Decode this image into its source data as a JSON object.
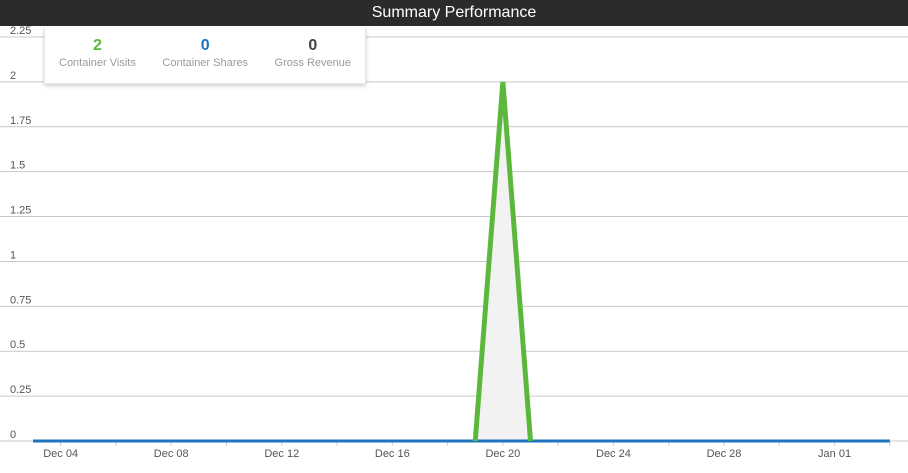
{
  "header": {
    "title": "Summary Performance"
  },
  "summary": {
    "stats": [
      {
        "value": "2",
        "label": "Container Visits",
        "color": "#5cb83c"
      },
      {
        "value": "0",
        "label": "Container Shares",
        "color": "#1e73be"
      },
      {
        "value": "0",
        "label": "Gross Revenue",
        "color": "#444444"
      }
    ]
  },
  "chart_data": {
    "type": "line",
    "title": "",
    "xlabel": "",
    "ylabel": "",
    "x_start": "2018-12-03",
    "ylim": [
      0,
      2.25
    ],
    "grid": true,
    "y_ticks": [
      "0",
      "0.25",
      "0.5",
      "0.75",
      "1",
      "1.25",
      "1.5",
      "1.75",
      "2",
      "2.25"
    ],
    "x_ticks": [
      "Dec 04",
      "Dec 08",
      "Dec 12",
      "Dec 16",
      "Dec 20",
      "Dec 24",
      "Dec 28",
      "Jan 01"
    ],
    "x": [
      "Dec 03",
      "Dec 04",
      "Dec 05",
      "Dec 06",
      "Dec 07",
      "Dec 08",
      "Dec 09",
      "Dec 10",
      "Dec 11",
      "Dec 12",
      "Dec 13",
      "Dec 14",
      "Dec 15",
      "Dec 16",
      "Dec 17",
      "Dec 18",
      "Dec 19",
      "Dec 20",
      "Dec 21",
      "Dec 22",
      "Dec 23",
      "Dec 24",
      "Dec 25",
      "Dec 26",
      "Dec 27",
      "Dec 28",
      "Dec 29",
      "Dec 30",
      "Dec 31",
      "Jan 01",
      "Jan 02",
      "Jan 03"
    ],
    "series": [
      {
        "name": "Container Visits",
        "color": "#5cb83c",
        "values": [
          0,
          0,
          0,
          0,
          0,
          0,
          0,
          0,
          0,
          0,
          0,
          0,
          0,
          0,
          0,
          0,
          0,
          2,
          0,
          0,
          0,
          0,
          0,
          0,
          0,
          0,
          0,
          0,
          0,
          0,
          0,
          0
        ]
      },
      {
        "name": "Container Shares",
        "color": "#1e73be",
        "values": [
          0,
          0,
          0,
          0,
          0,
          0,
          0,
          0,
          0,
          0,
          0,
          0,
          0,
          0,
          0,
          0,
          0,
          0,
          0,
          0,
          0,
          0,
          0,
          0,
          0,
          0,
          0,
          0,
          0,
          0,
          0,
          0
        ]
      }
    ]
  }
}
